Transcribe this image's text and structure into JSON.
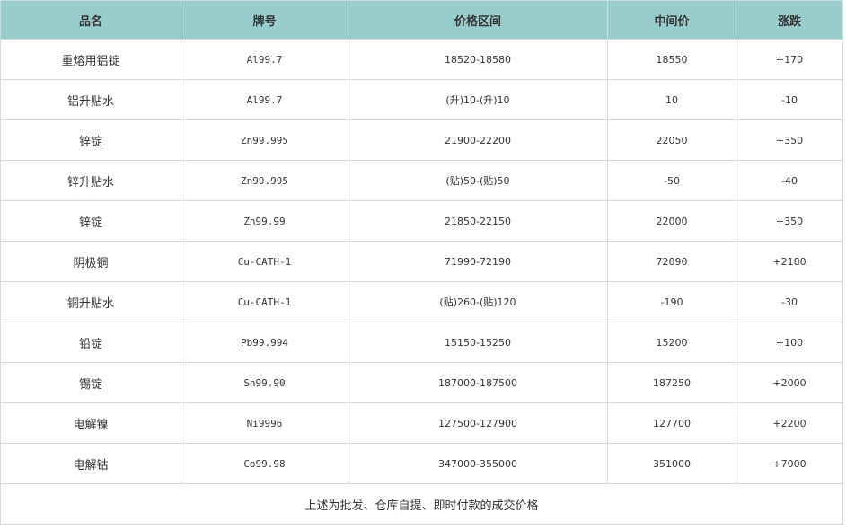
{
  "table": {
    "headers": [
      "品名",
      "牌号",
      "价格区间",
      "中间价",
      "涨跌"
    ],
    "rows": [
      {
        "name": "重熔用铝锭",
        "grade": "Al99.7",
        "range": "18520-18580",
        "mid": "18550",
        "change": "+170"
      },
      {
        "name": "铝升贴水",
        "grade": "Al99.7",
        "range": "(升)10-(升)10",
        "mid": "10",
        "change": "-10"
      },
      {
        "name": "锌锭",
        "grade": "Zn99.995",
        "range": "21900-22200",
        "mid": "22050",
        "change": "+350"
      },
      {
        "name": "锌升贴水",
        "grade": "Zn99.995",
        "range": "(贴)50-(贴)50",
        "mid": "-50",
        "change": "-40"
      },
      {
        "name": "锌锭",
        "grade": "Zn99.99",
        "range": "21850-22150",
        "mid": "22000",
        "change": "+350"
      },
      {
        "name": "阴极铜",
        "grade": "Cu-CATH-1",
        "range": "71990-72190",
        "mid": "72090",
        "change": "+2180"
      },
      {
        "name": "铜升贴水",
        "grade": "Cu-CATH-1",
        "range": "(贴)260-(贴)120",
        "mid": "-190",
        "change": "-30"
      },
      {
        "name": "铅锭",
        "grade": "Pb99.994",
        "range": "15150-15250",
        "mid": "15200",
        "change": "+100"
      },
      {
        "name": "锡锭",
        "grade": "Sn99.90",
        "range": "187000-187500",
        "mid": "187250",
        "change": "+2000"
      },
      {
        "name": "电解镍",
        "grade": "Ni9996",
        "range": "127500-127900",
        "mid": "127700",
        "change": "+2200"
      },
      {
        "name": "电解钴",
        "grade": "Co99.98",
        "range": "347000-355000",
        "mid": "351000",
        "change": "+7000"
      }
    ],
    "footnote": "上述为批发、仓库自提、即时付款的成交价格"
  },
  "colors": {
    "header_bg": "#99cccc",
    "border": "#d9d9d9",
    "text": "#333333"
  }
}
